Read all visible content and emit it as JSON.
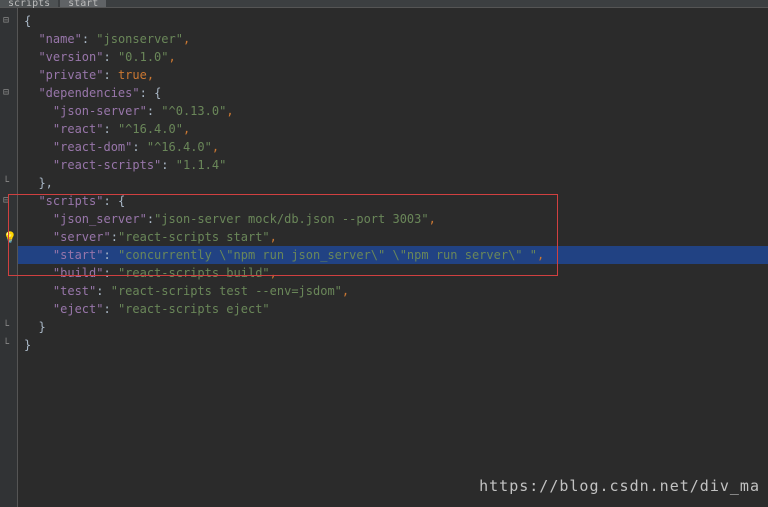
{
  "tabs": {
    "items": [
      "scripts",
      "start"
    ]
  },
  "code": {
    "l1": "{",
    "l2_key": "\"name\"",
    "l2_val": "\"jsonserver\"",
    "l3_key": "\"version\"",
    "l3_val": "\"0.1.0\"",
    "l4_key": "\"private\"",
    "l4_val": "true",
    "l5_key": "\"dependencies\"",
    "l5_brace": "{",
    "l6_key": "\"json-server\"",
    "l6_val": "\"^0.13.0\"",
    "l7_key": "\"react\"",
    "l7_val": "\"^16.4.0\"",
    "l8_key": "\"react-dom\"",
    "l8_val": "\"^16.4.0\"",
    "l9_key": "\"react-scripts\"",
    "l9_val": "\"1.1.4\"",
    "l10": "},",
    "l11_key": "\"scripts\"",
    "l11_brace": "{",
    "l12_key": "\"json_server\"",
    "l12_val": "\"json-server mock/db.json --port 3003\"",
    "l13_key": "\"server\"",
    "l13_val": "\"react-scripts start\"",
    "l14_key": "\"start\"",
    "l14_val": "\"concurrently \\\"npm run json_server\\\" \\\"npm run server\\\" \"",
    "l15_key": "\"build\"",
    "l15_val": "\"react-scripts build\"",
    "l16_key": "\"test\"",
    "l16_val": "\"react-scripts test --env=jsdom\"",
    "l17_key": "\"eject\"",
    "l17_val": "\"react-scripts eject\"",
    "l18": "}",
    "l19": "}"
  },
  "watermark": "https://blog.csdn.net/div_ma"
}
